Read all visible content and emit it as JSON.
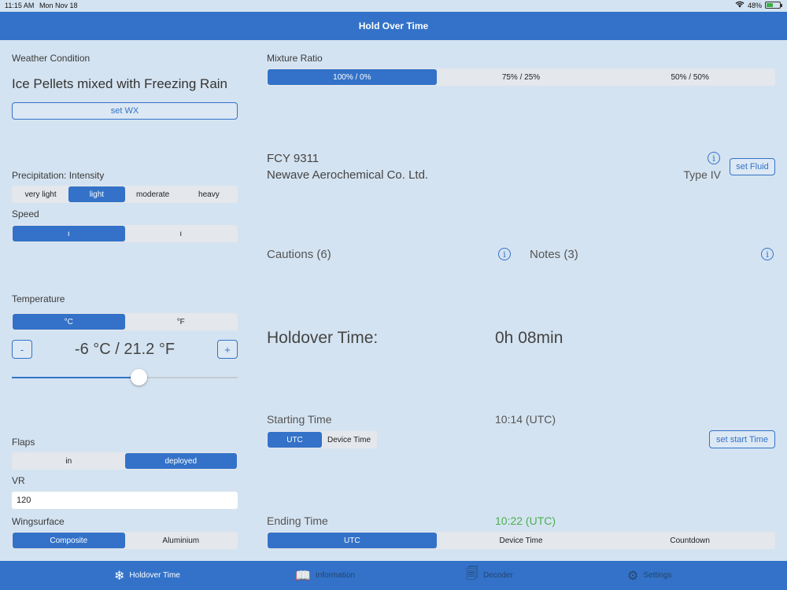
{
  "status": {
    "time": "11:15 AM",
    "date": "Mon Nov 18",
    "battery": "48%",
    "battery_level": 0.48
  },
  "title": "Hold Over Time",
  "weather": {
    "label": "Weather Condition",
    "value": "Ice Pellets mixed with Freezing Rain",
    "button": "set WX"
  },
  "precip": {
    "label": "Precipitation: Intensity",
    "options": [
      "very light",
      "light",
      "moderate",
      "heavy"
    ],
    "selected": 1
  },
  "speed": {
    "label": "Speed",
    "options": [
      "ı",
      "ı"
    ],
    "selected": 0
  },
  "temperature": {
    "label": "Temperature",
    "units": [
      "°C",
      "°F"
    ],
    "selected": 0,
    "minus": "-",
    "plus": "+",
    "value": "-6 °C / 21.2 °F",
    "slider_fraction": 0.56
  },
  "flaps": {
    "label": "Flaps",
    "options": [
      "in",
      "deployed"
    ],
    "selected": 1
  },
  "vr": {
    "label": "VR",
    "value": "120"
  },
  "wingsurface": {
    "label": "Wingsurface",
    "options": [
      "Composite",
      "Aluminium"
    ],
    "selected": 0
  },
  "mixture": {
    "label": "Mixture Ratio",
    "options": [
      "100% / 0%",
      "75% / 25%",
      "50% / 50%"
    ],
    "selected": 0
  },
  "fluid": {
    "name": "FCY 9311",
    "maker": "Newave Aerochemical Co. Ltd.",
    "type": "Type IV",
    "info_icon": "i",
    "button": "set Fluid"
  },
  "cautions": {
    "label": "Cautions (6)",
    "info_icon": "i"
  },
  "notes": {
    "label": "Notes (3)",
    "info_icon": "i"
  },
  "holdover": {
    "label": "Holdover Time:",
    "value": "0h 08min"
  },
  "starting": {
    "label": "Starting Time",
    "value": "10:14 (UTC)",
    "options": [
      "UTC",
      "Device Time"
    ],
    "selected": 0,
    "button": "set start Time"
  },
  "ending": {
    "label": "Ending Time",
    "value": "10:22 (UTC)",
    "value_color": "#4caf50",
    "options": [
      "UTC",
      "Device Time",
      "Countdown"
    ],
    "selected": 0
  },
  "tabs": [
    {
      "label": "Holdover Time",
      "icon": "❄"
    },
    {
      "label": "Information",
      "icon": "📖"
    },
    {
      "label": "Decoder",
      "icon": "🗐"
    },
    {
      "label": "Settings",
      "icon": "⚙"
    }
  ],
  "colors": {
    "accent": "#3372c8",
    "background": "#d4e3f1"
  }
}
